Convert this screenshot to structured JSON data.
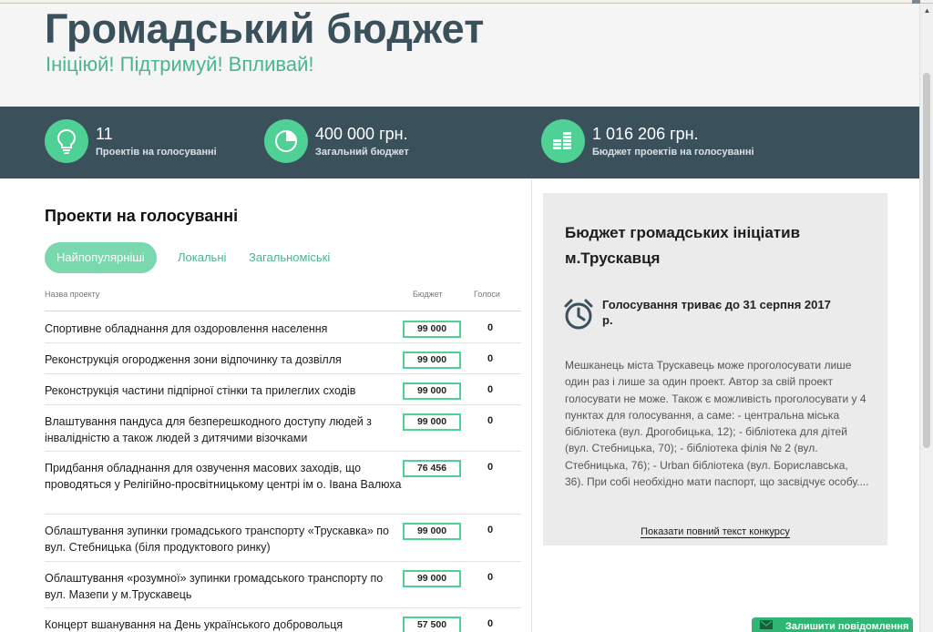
{
  "hero": {
    "title": "Громадський бюджет",
    "subtitle": "Ініціюй! Підтримуй! Впливай!"
  },
  "stats": [
    {
      "icon": "lightbulb-icon",
      "value": "11",
      "label": "Проектів на голосуванні"
    },
    {
      "icon": "pie-chart-icon",
      "value": "400 000 грн.",
      "label": "Загальний бюджет"
    },
    {
      "icon": "coins-icon",
      "value": "1 016 206 грн.",
      "label": "Бюджет проектів на голосуванні"
    }
  ],
  "projects": {
    "title": "Проекти на голосуванні",
    "tabs": [
      {
        "label": "Найпопулярніші",
        "active": true
      },
      {
        "label": "Локальні",
        "active": false
      },
      {
        "label": "Загальноміські",
        "active": false
      }
    ],
    "columns": {
      "name": "Назва проекту",
      "budget": "Бюджет",
      "votes": "Голоси"
    },
    "rows": [
      {
        "name": "Спортивне обладнання для оздоровлення населення",
        "budget": "99 000",
        "votes": "0"
      },
      {
        "name": "Реконструкція огородження зони відпочинку та дозвілля",
        "budget": "99 000",
        "votes": "0"
      },
      {
        "name": "Реконструкція частини підпірної стінки та прилеглих сходів",
        "budget": "99 000",
        "votes": "0"
      },
      {
        "name": "Влаштування пандуса для безперешкодного доступу людей з інвалідністю а також людей з дитячими візочками",
        "budget": "99 000",
        "votes": "0"
      },
      {
        "name": "Придбання обладнання для озвучення масових заходів, що проводяться у Релігійно-просвітницькому центрі ім о. Івана Валюха",
        "budget": "76 456",
        "votes": "0"
      },
      {
        "name": "Облаштування зупинки громадського транспорту «Трускавка» по вул. Стебницька (біля продуктового ринку)",
        "budget": "99 000",
        "votes": "0"
      },
      {
        "name": "Облаштування «розумної» зупинки громадського транспорту по вул. Мазепи у м.Трускавець",
        "budget": "99 000",
        "votes": "0"
      },
      {
        "name": "Концерт вшанування на День українського добровольця",
        "budget": "57 500",
        "votes": "0"
      }
    ]
  },
  "panel": {
    "title": "Бюджет громадських ініціатив м.Трускавця",
    "voting_until": "Голосування триває до 31 серпня 2017 р.",
    "description": "Мешканець міста Трускавець може проголосувати лише один раз і лише за один проект. Автор за свій проект голосувати не може. Також є можливість проголосувати у 4 пунктах для голосування, а саме: - центральна міська бібліотека (вул. Дрогобицька, 12); - бібліотека для дітей (вул. Стебницька, 70); - бібліотека філія № 2 (вул. Стебницька, 76); - Urban бібліотека (вул. Бориславська, 36). При собі необхідно мати паспорт, що засвідчує особу....",
    "more_link": "Показати повний текст конкурсу"
  },
  "message_button": {
    "label": "Залишити повідомлення",
    "icon": "envelope-icon"
  },
  "colors": {
    "dark": "#3a515c",
    "accent": "#4fd094",
    "accent_text": "#4ab58f",
    "panel_bg": "#ebebeb"
  }
}
